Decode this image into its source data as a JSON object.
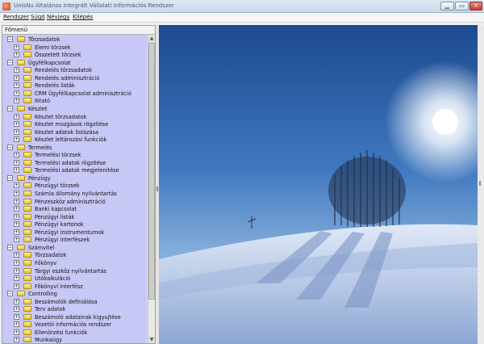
{
  "window": {
    "title": "UnisNu Általános Integrált Vállalati Információs Rendszer",
    "min_label": "▁",
    "max_label": "▭",
    "close_label": "✕"
  },
  "menu": [
    {
      "label": "Rendszer"
    },
    {
      "label": "Súgó"
    },
    {
      "label": "Névjegy"
    },
    {
      "label": "Kilépés"
    }
  ],
  "panel": {
    "title": "Főmenü"
  },
  "tree": [
    {
      "label": "Törzsadatok",
      "level": 0,
      "expanded": true
    },
    {
      "label": "Elemi törzsek",
      "level": 1
    },
    {
      "label": "Összetett törzsek",
      "level": 1
    },
    {
      "label": "Ügyfélkapcsolat",
      "level": 0,
      "expanded": true
    },
    {
      "label": "Rendelés törzsadatok",
      "level": 1
    },
    {
      "label": "Rendelés adminisztráció",
      "level": 1
    },
    {
      "label": "Rendelés listák",
      "level": 1
    },
    {
      "label": "CRM Ügyfélkapcsolat adminisztráció",
      "level": 1
    },
    {
      "label": "Iktató",
      "level": 1
    },
    {
      "label": "Készlet",
      "level": 0,
      "expanded": true
    },
    {
      "label": "Készlet törzsadatok",
      "level": 1
    },
    {
      "label": "Készlet mozgások rögzítése",
      "level": 1
    },
    {
      "label": "Készlet adatok listázása",
      "level": 1
    },
    {
      "label": "Készlet leltározási funkciók",
      "level": 1
    },
    {
      "label": "Termelés",
      "level": 0,
      "expanded": true
    },
    {
      "label": "Termelési törzsek",
      "level": 1
    },
    {
      "label": "Termelési adatok rögzítése",
      "level": 1
    },
    {
      "label": "Termelési adatok megjelenítése",
      "level": 1
    },
    {
      "label": "Pénzügy",
      "level": 0,
      "expanded": true
    },
    {
      "label": "Pénzügyi törzsek",
      "level": 1
    },
    {
      "label": "Számla állomány nyilvántartás",
      "level": 1
    },
    {
      "label": "Pénzeszköz adminisztráció",
      "level": 1
    },
    {
      "label": "Banki kapcsolat",
      "level": 1
    },
    {
      "label": "Pénzügyi listák",
      "level": 1
    },
    {
      "label": "Pénzügyi kartonok",
      "level": 1
    },
    {
      "label": "Pénzügyi instrumentumok",
      "level": 1
    },
    {
      "label": "Pénzügyi interfészek",
      "level": 1
    },
    {
      "label": "Számvitel",
      "level": 0,
      "expanded": true
    },
    {
      "label": "Törzsadatok",
      "level": 1
    },
    {
      "label": "Főkönyv",
      "level": 1
    },
    {
      "label": "Tárgyi eszköz nyilvántartás",
      "level": 1
    },
    {
      "label": "Utókalkuláció",
      "level": 1
    },
    {
      "label": "Főkönyvi interfész",
      "level": 1
    },
    {
      "label": "Controlling",
      "level": 0,
      "expanded": true
    },
    {
      "label": "Beszámolók definiálása",
      "level": 1
    },
    {
      "label": "Terv adatok",
      "level": 1
    },
    {
      "label": "Beszámoló adatainak kigyujtése",
      "level": 1
    },
    {
      "label": "Vezetöi információs rendszer",
      "level": 1
    },
    {
      "label": "Ellenörzési funkciók",
      "level": 1
    },
    {
      "label": "Munkaügy",
      "level": 1
    }
  ],
  "colors": {
    "tree_bg": "#c8c8f6",
    "sky_top": "#1f4e93",
    "sky_bottom": "#8fb6e0",
    "snow": "#e8eef8"
  }
}
